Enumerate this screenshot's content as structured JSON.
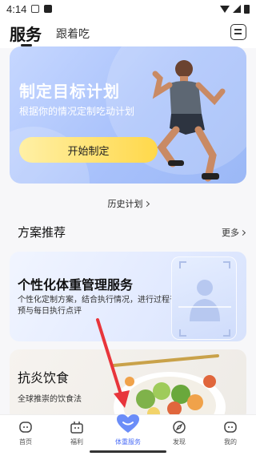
{
  "status_bar": {
    "time": "4:14"
  },
  "top_tabs": {
    "service": "服务",
    "follow": "跟着吃"
  },
  "hero": {
    "title": "制定目标计划",
    "subtitle": "根据你的情况定制吃动计划",
    "button": "开始制定"
  },
  "history_link": "历史计划",
  "plans": {
    "title": "方案推荐",
    "more": "更多",
    "cards": [
      {
        "title": "个性化体重管理服务",
        "desc": "个性化定制方案，结合执行情况，进行过程干预与每日执行点评"
      },
      {
        "title": "抗炎饮食",
        "desc": "全球推崇的饮食法"
      }
    ]
  },
  "tab_bar": {
    "items": [
      {
        "label": "首页",
        "icon": "home-face-icon"
      },
      {
        "label": "福利",
        "icon": "gift-icon"
      },
      {
        "label": "体重服务",
        "icon": "heart-icon"
      },
      {
        "label": "发现",
        "icon": "compass-icon"
      },
      {
        "label": "我的",
        "icon": "profile-face-icon"
      }
    ],
    "active_index": 2
  },
  "colors": {
    "accent": "#4a6cf7",
    "hero_button": "#ffd84a",
    "arrow": "#e8353b"
  }
}
